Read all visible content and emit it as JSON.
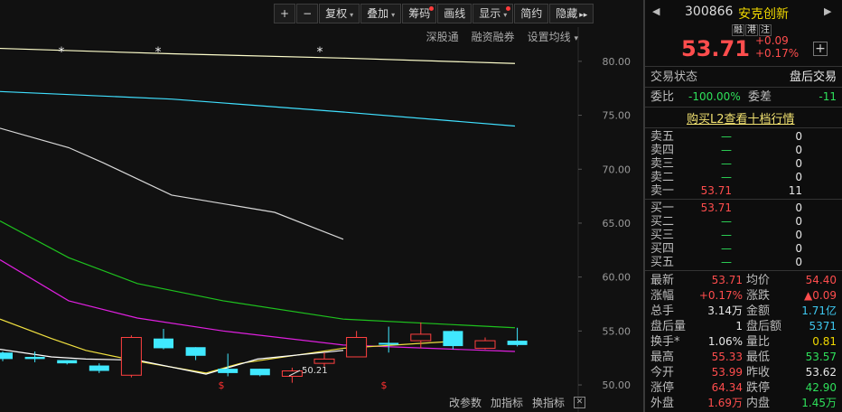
{
  "toolbar": {
    "buttons": [
      {
        "label": "+",
        "arrow": false,
        "dot": false
      },
      {
        "label": "−",
        "arrow": false,
        "dot": false
      },
      {
        "label": "复权",
        "arrow": true,
        "dot": false
      },
      {
        "label": "叠加",
        "arrow": true,
        "dot": false
      },
      {
        "label": "筹码",
        "arrow": false,
        "dot": true
      },
      {
        "label": "画线",
        "arrow": false,
        "dot": false
      },
      {
        "label": "显示",
        "arrow": true,
        "dot": true
      },
      {
        "label": "简约",
        "arrow": false,
        "dot": false
      },
      {
        "label": "隐藏",
        "arrow": false,
        "dot": false,
        "suffix": "▸▸"
      }
    ]
  },
  "chart_links": {
    "shenhk": "深股通",
    "margin": "融资融券",
    "ma_setting": "设置均线",
    "ma_arrow": "▾"
  },
  "bottom_links": {
    "params": "改参数",
    "add_indicator": "加指标",
    "switch_indicator": "换指标",
    "close": "✕"
  },
  "chart_data": {
    "type": "candlestick",
    "y_ticks": [
      "80.00",
      "75.00",
      "70.00",
      "65.00",
      "60.00",
      "55.00",
      "50.00"
    ],
    "ylim": [
      49.5,
      82
    ],
    "low_annotation": "50.21",
    "star_marks": [
      "*",
      "*",
      "*"
    ],
    "s_marks": [
      "$",
      "$"
    ],
    "candles": [
      {
        "o": 53.0,
        "c": 52.4,
        "h": 53.1,
        "l": 52.2,
        "type": "flat"
      },
      {
        "o": 52.6,
        "c": 52.4,
        "h": 53.1,
        "l": 52.1,
        "type": "flat"
      },
      {
        "o": 52.3,
        "c": 52.0,
        "h": 52.3,
        "l": 51.9,
        "type": "flat"
      },
      {
        "o": 51.8,
        "c": 51.3,
        "h": 52.0,
        "l": 51.1,
        "type": "down"
      },
      {
        "o": 50.9,
        "c": 54.4,
        "h": 54.6,
        "l": 50.7,
        "type": "up"
      },
      {
        "o": 54.3,
        "c": 53.4,
        "h": 55.2,
        "l": 53.3,
        "type": "down"
      },
      {
        "o": 53.5,
        "c": 52.7,
        "h": 53.5,
        "l": 52.3,
        "type": "down"
      },
      {
        "o": 51.5,
        "c": 51.1,
        "h": 52.9,
        "l": 50.8,
        "type": "down"
      },
      {
        "o": 51.5,
        "c": 50.9,
        "h": 51.5,
        "l": 50.8,
        "type": "down"
      },
      {
        "o": 50.8,
        "c": 51.3,
        "h": 51.6,
        "l": 50.2,
        "type": "up"
      },
      {
        "o": 52.0,
        "c": 52.4,
        "h": 53.0,
        "l": 51.7,
        "type": "up"
      },
      {
        "o": 52.6,
        "c": 54.4,
        "h": 55.0,
        "l": 52.6,
        "type": "up"
      },
      {
        "o": 53.9,
        "c": 53.9,
        "h": 55.4,
        "l": 53.0,
        "type": "flat"
      },
      {
        "o": 54.1,
        "c": 54.7,
        "h": 55.8,
        "l": 53.4,
        "type": "up"
      },
      {
        "o": 55.0,
        "c": 53.6,
        "h": 55.1,
        "l": 53.3,
        "type": "down"
      },
      {
        "o": 53.4,
        "c": 54.1,
        "h": 54.4,
        "l": 53.3,
        "type": "up"
      },
      {
        "o": 54.1,
        "c": 53.7,
        "h": 55.3,
        "l": 53.57,
        "type": "down"
      }
    ],
    "ma_lines": [
      {
        "color": "#ffffcc",
        "points": [
          [
            0,
            81.2
          ],
          [
            1,
            80.7
          ],
          [
            2,
            80.3
          ],
          [
            3,
            79.8
          ]
        ]
      },
      {
        "color": "#40e0ff",
        "points": [
          [
            0,
            77.2
          ],
          [
            1,
            76.5
          ],
          [
            2,
            75.3
          ],
          [
            3,
            74.0
          ]
        ]
      },
      {
        "color": "#d8d8d8",
        "points": [
          [
            0,
            73.8
          ],
          [
            0.4,
            72.0
          ],
          [
            0.6,
            70.6
          ],
          [
            1,
            67.6
          ],
          [
            1.6,
            66.0
          ],
          [
            2,
            63.5
          ]
        ]
      },
      {
        "color": "#1ec21e",
        "points": [
          [
            0,
            65.2
          ],
          [
            0.4,
            61.8
          ],
          [
            0.8,
            59.4
          ],
          [
            1.3,
            57.8
          ],
          [
            2,
            56.1
          ],
          [
            3,
            55.3
          ]
        ]
      },
      {
        "color": "#e020e0",
        "points": [
          [
            0,
            61.6
          ],
          [
            0.4,
            57.8
          ],
          [
            0.8,
            56.2
          ],
          [
            1.3,
            55.0
          ],
          [
            2,
            53.7
          ],
          [
            3,
            53.1
          ]
        ]
      },
      {
        "color": "#f0e040",
        "points": [
          [
            0,
            56.1
          ],
          [
            0.3,
            54.3
          ],
          [
            0.5,
            53.2
          ],
          [
            0.8,
            52.2
          ],
          [
            1.2,
            51.1
          ],
          [
            1.4,
            52.0
          ],
          [
            2,
            53.4
          ],
          [
            2.6,
            54.0
          ]
        ]
      },
      {
        "color": "#ffffff",
        "points": [
          [
            0,
            53.3
          ],
          [
            0.3,
            52.6
          ],
          [
            0.5,
            52.4
          ],
          [
            0.8,
            52.3
          ],
          [
            1.2,
            51.0
          ],
          [
            1.5,
            52.4
          ],
          [
            2,
            53.2
          ]
        ]
      }
    ]
  },
  "stock": {
    "code": "300866",
    "name": "安克创新",
    "badges": [
      "融",
      "港",
      "注"
    ],
    "price": "53.71",
    "change": "+0.09",
    "change_pct": "+0.17%",
    "add_btn": "+"
  },
  "trade_status": {
    "label": "交易状态",
    "value": "盘后交易"
  },
  "weibi": {
    "label": "委比",
    "value": "-100.00%",
    "label2": "委差",
    "value2": "-11"
  },
  "l2_link": "购买L2查看十档行情",
  "asks": [
    {
      "label": "卖五",
      "price": "—",
      "vol": "0"
    },
    {
      "label": "卖四",
      "price": "—",
      "vol": "0"
    },
    {
      "label": "卖三",
      "price": "—",
      "vol": "0"
    },
    {
      "label": "卖二",
      "price": "—",
      "vol": "0"
    },
    {
      "label": "卖一",
      "price": "53.71",
      "vol": "11"
    }
  ],
  "bids": [
    {
      "label": "买一",
      "price": "53.71",
      "vol": "0"
    },
    {
      "label": "买二",
      "price": "—",
      "vol": "0"
    },
    {
      "label": "买三",
      "price": "—",
      "vol": "0"
    },
    {
      "label": "买四",
      "price": "—",
      "vol": "0"
    },
    {
      "label": "买五",
      "price": "—",
      "vol": "0"
    }
  ],
  "stats": [
    {
      "l1": "最新",
      "v1": "53.71",
      "c1": "red",
      "l2": "均价",
      "v2": "54.40",
      "c2": "red"
    },
    {
      "l1": "涨幅",
      "v1": "+0.17%",
      "c1": "red",
      "l2": "涨跌",
      "v2": "▲0.09",
      "c2": "red"
    },
    {
      "l1": "总手",
      "v1": "3.14万",
      "c1": "white",
      "l2": "金额",
      "v2": "1.71亿",
      "c2": "cyan"
    },
    {
      "l1": "盘后量",
      "v1": "1",
      "c1": "white",
      "l2": "盘后额",
      "v2": "5371",
      "c2": "cyan"
    },
    {
      "l1": "换手*",
      "v1": "1.06%",
      "c1": "white",
      "l2": "量比",
      "v2": "0.81",
      "c2": "yellow"
    },
    {
      "l1": "最高",
      "v1": "55.33",
      "c1": "red",
      "l2": "最低",
      "v2": "53.57",
      "c2": "green"
    },
    {
      "l1": "今开",
      "v1": "53.99",
      "c1": "red",
      "l2": "昨收",
      "v2": "53.62",
      "c2": "white"
    },
    {
      "l1": "涨停",
      "v1": "64.34",
      "c1": "red",
      "l2": "跌停",
      "v2": "42.90",
      "c2": "green"
    },
    {
      "l1": "外盘",
      "v1": "1.69万",
      "c1": "red",
      "l2": "内盘",
      "v2": "1.45万",
      "c2": "green"
    }
  ]
}
